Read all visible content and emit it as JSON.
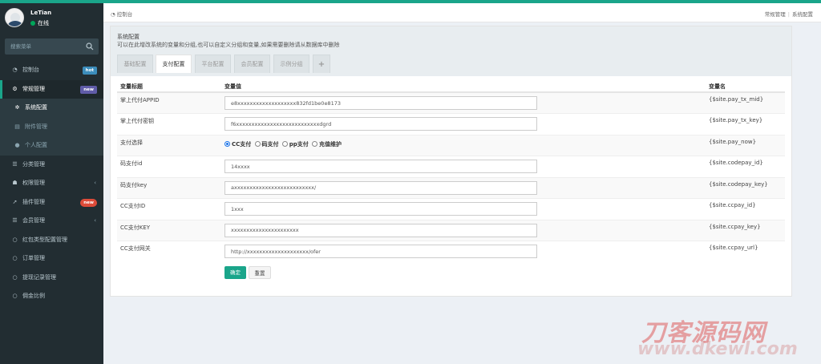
{
  "user": {
    "name": "LeTian",
    "status": "在线"
  },
  "search": {
    "placeholder": "搜索菜单"
  },
  "sidebar": {
    "items": [
      {
        "label": "控制台",
        "icon": "dashboard-icon",
        "badge": "hot"
      },
      {
        "label": "常规管理",
        "icon": "cogs-icon",
        "badge": "new"
      },
      {
        "label": "系统配置",
        "icon": "gear-icon"
      },
      {
        "label": "附件管理",
        "icon": "file-icon"
      },
      {
        "label": "个人配置",
        "icon": "user-icon"
      },
      {
        "label": "分类管理",
        "icon": "list-icon"
      },
      {
        "label": "权限管理",
        "icon": "group-icon"
      },
      {
        "label": "插件管理",
        "icon": "rocket-icon",
        "badge": "new"
      },
      {
        "label": "会员管理",
        "icon": "list-icon"
      },
      {
        "label": "红包类型配置管理",
        "icon": "circle-icon"
      },
      {
        "label": "订单管理",
        "icon": "circle-icon"
      },
      {
        "label": "提现记录管理",
        "icon": "circle-icon"
      },
      {
        "label": "佣金比例",
        "icon": "circle-icon"
      }
    ]
  },
  "header": {
    "breadcrumb": "控制台",
    "right_crumbs": [
      "常规管理",
      "系统配置"
    ]
  },
  "panel": {
    "title": "系统配置",
    "description": "可以在此增改系统的变量和分组,也可以自定义分组和变量,如果需要删除请从数据库中删除",
    "tabs": [
      "基础配置",
      "支付配置",
      "平台配置",
      "会员配置",
      "示例分组",
      "+"
    ]
  },
  "table": {
    "headers": [
      "变量标题",
      "变量值",
      "变量名"
    ],
    "rows": [
      {
        "title": "掌上代付APPID",
        "value": "e8xxxxxxxxxxxxxxxxxxx832fd1be0e8173",
        "name": "{$site.pay_tx_mid}"
      },
      {
        "title": "掌上代付密钥",
        "value": "f6xxxxxxxxxxxxxxxxxxxxxxxxxxxdgrd",
        "name": "{$site.pay_tx_key}"
      },
      {
        "title": "支付选择",
        "value": "",
        "name": "{$site.pay_now}"
      },
      {
        "title": "码支付id",
        "value": "14xxxx",
        "name": "{$site.codepay_id}"
      },
      {
        "title": "码支付key",
        "value": "axxxxxxxxxxxxxxxxxxxxxxxxxx/",
        "name": "{$site.codepay_key}"
      },
      {
        "title": "CC支付ID",
        "value": "1xxx",
        "name": "{$site.ccpay_id}"
      },
      {
        "title": "CC支付KEY",
        "value": "xxxxxxxxxxxxxxxxxxxxxx",
        "name": "{$site.ccpay_key}"
      },
      {
        "title": "CC支付网关",
        "value": "http://xxxxxxxxxxxxxxxxxxxx/ofer",
        "name": "{$site.ccpay_url}"
      }
    ],
    "radio_options": [
      "CC支付",
      "码支付",
      "pp支付",
      "充值维护"
    ]
  },
  "buttons": {
    "ok": "确定",
    "reset": "重置"
  },
  "watermark": {
    "main": "刀客源码网",
    "sub": "www.dkewl.com"
  },
  "colors": {
    "accent": "#1aa58a",
    "sidebar_bg": "#222d32",
    "hot": "#3c8dbc",
    "new_purple": "#605ca8",
    "new_red": "#dd4b39"
  }
}
